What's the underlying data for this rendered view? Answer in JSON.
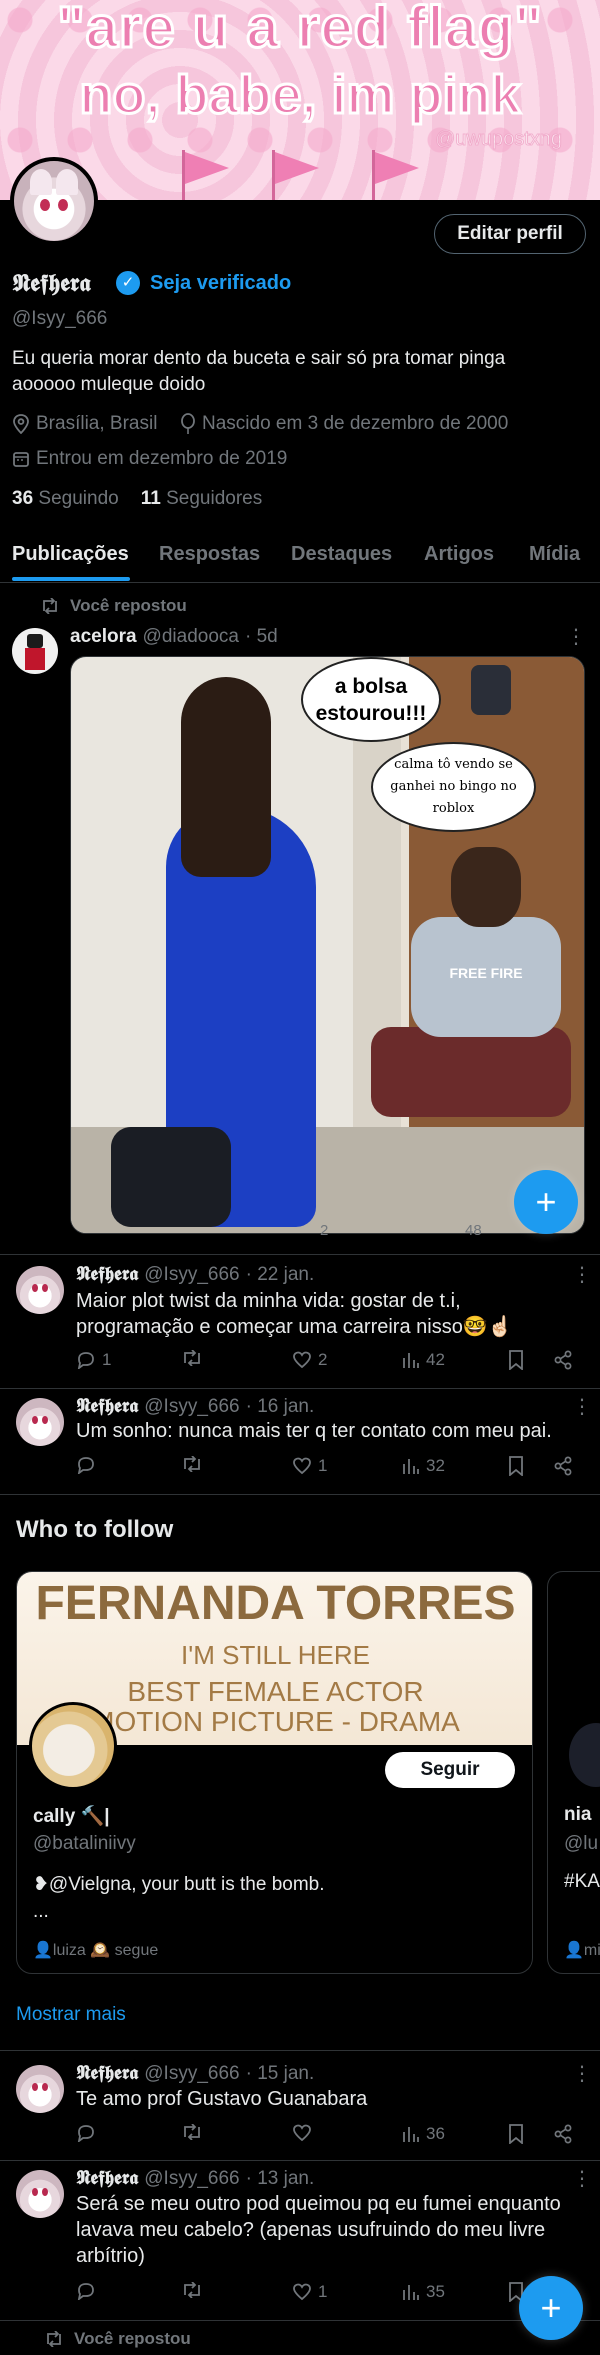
{
  "banner": {
    "line1": "\"are u a red flag\"",
    "line2": "no, babe, im pink",
    "watermark": "@uwupostxng",
    "colors": {
      "text": "#ec7fb1",
      "background": "#f6c6dc"
    }
  },
  "profile": {
    "edit_button": "Editar perfil",
    "display_name": "𝕹𝖊𝖋𝖍𝖊𝖗𝖆",
    "verify_link": "Seja verificado",
    "handle": "@Isyy_666",
    "bio": "Eu queria morar dento da buceta e sair só pra tomar pinga aooooo muleque doido",
    "location": "Brasília, Brasil",
    "birth": "Nascido em 3 de dezembro de 2000",
    "joined": "Entrou em dezembro de 2019",
    "following_count": "36",
    "following_label": "Seguindo",
    "followers_count": "11",
    "followers_label": "Seguidores"
  },
  "tabs": [
    {
      "label": "Publicações",
      "active": true
    },
    {
      "label": "Respostas",
      "active": false
    },
    {
      "label": "Destaques",
      "active": false
    },
    {
      "label": "Artigos",
      "active": false
    },
    {
      "label": "Mídia",
      "active": false
    }
  ],
  "posts": [
    {
      "repost_label": "Você repostou",
      "name": "acelora",
      "handle": "@diadooca",
      "time": "· 5d",
      "meme": {
        "bubble1": "a bolsa estourou!!!",
        "bubble2": "calma tô vendo se ganhei no bingo no roblox",
        "shirt_text": "FREE FIRE"
      },
      "actions": {
        "replies": "",
        "reposts": "2",
        "likes": "",
        "views": "48"
      }
    },
    {
      "name": "𝕹𝖊𝖋𝖍𝖊𝖗𝖆",
      "handle": "@Isyy_666",
      "time": "· 22 jan.",
      "text": "Maior plot twist da minha vida: gostar de t.i, programação e começar uma carreira nisso🤓☝🏻",
      "actions": {
        "replies": "1",
        "reposts": "",
        "likes": "2",
        "views": "42"
      }
    },
    {
      "name": "𝕹𝖊𝖋𝖍𝖊𝖗𝖆",
      "handle": "@Isyy_666",
      "time": "· 16 jan.",
      "text": "Um sonho: nunca mais ter q ter contato com meu pai.",
      "actions": {
        "replies": "",
        "reposts": "",
        "likes": "1",
        "views": "32"
      }
    },
    {
      "name": "𝕹𝖊𝖋𝖍𝖊𝖗𝖆",
      "handle": "@Isyy_666",
      "time": "· 15 jan.",
      "text": "Te amo prof Gustavo Guanabara",
      "actions": {
        "replies": "",
        "reposts": "",
        "likes": "",
        "views": "36"
      }
    },
    {
      "name": "𝕹𝖊𝖋𝖍𝖊𝖗𝖆",
      "handle": "@Isyy_666",
      "time": "· 13 jan.",
      "text": "Será se meu outro pod queimou pq eu fumei enquanto lavava meu cabelo? (apenas usufruindo do meu livre arbítrio)",
      "actions": {
        "replies": "",
        "reposts": "",
        "likes": "1",
        "views": "35"
      }
    }
  ],
  "bottom_repost_label": "Você repostou",
  "who_to_follow": {
    "title": "Who to follow",
    "card1": {
      "banner_line1": "FERNANDA TORRES",
      "banner_line2": "I'M STILL HERE",
      "banner_line3": "BEST FEMALE ACTOR",
      "banner_line4": "MOTION PICTURE - DRAMA",
      "follow_button": "Seguir",
      "name": "cally 🔨|",
      "handle": "@bataliniivy",
      "bio_line1": "❥@Vielgna, your butt is the bomb.",
      "bio_line2": "...",
      "followed_by": "👤luiza 🕰️ segue"
    },
    "card2": {
      "name": "nia",
      "handle": "@lu",
      "bio": "#KA",
      "followed_by": "👤mi"
    },
    "show_more": "Mostrar mais"
  },
  "fab": {
    "label": "+"
  },
  "icons": {
    "verified": "verified-badge-icon",
    "location": "location-pin-icon",
    "birthday": "balloon-icon",
    "calendar": "calendar-icon",
    "repost": "repost-icon",
    "reply": "reply-bubble-icon",
    "like": "heart-icon",
    "views": "views-bar-icon",
    "bookmark": "bookmark-icon",
    "share": "share-icon",
    "more": "more-dots-icon"
  },
  "colors": {
    "accent": "#1d9bf0",
    "muted": "#71767b",
    "text": "#e7e9ea",
    "background": "#000000"
  }
}
